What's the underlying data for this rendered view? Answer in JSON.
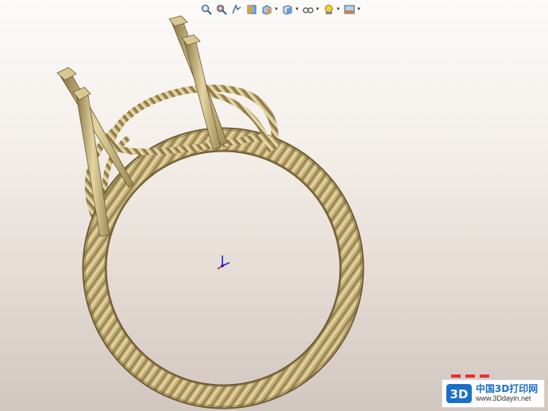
{
  "toolbar": {
    "items": [
      {
        "icon": "zoom-to-fit-icon"
      },
      {
        "icon": "zoom-to-area-icon"
      },
      {
        "icon": "previous-view-icon"
      },
      {
        "icon": "section-view-icon"
      },
      {
        "icon": "view-orientation-icon",
        "dropdown": true
      },
      {
        "icon": "display-style-icon",
        "dropdown": true
      },
      {
        "icon": "hide-show-items-icon",
        "dropdown": true
      },
      {
        "icon": "edit-appearance-icon",
        "dropdown": true
      },
      {
        "icon": "apply-scene-icon",
        "dropdown": true
      }
    ]
  },
  "colors": {
    "gold": "#c8b27a",
    "gold_dark": "#8a7544",
    "gold_light": "#e6d7a6",
    "triad_x": "#d01010",
    "triad_y": "#1010d0"
  },
  "watermark": {
    "logo_text": "3D",
    "title": "中国3D打印网",
    "url": "www.3Ddayin.net"
  }
}
